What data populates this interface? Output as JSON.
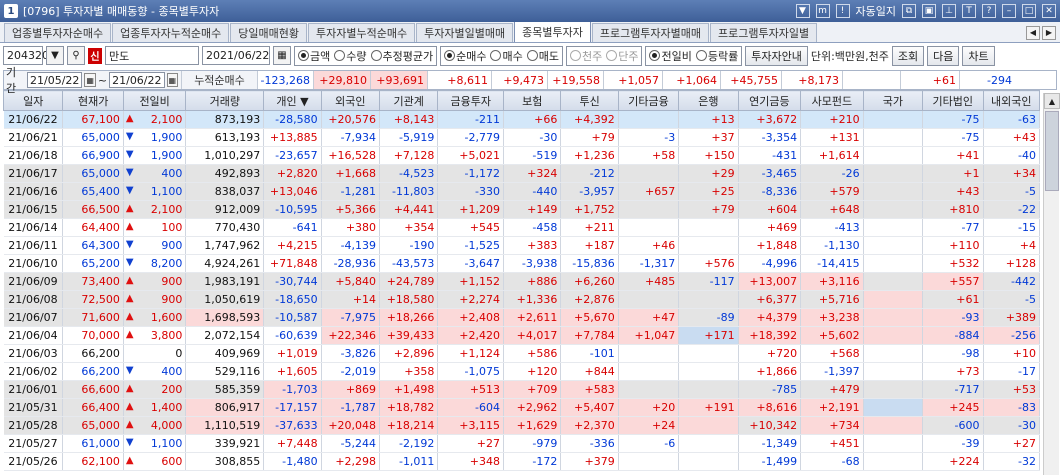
{
  "window": {
    "number": "1",
    "title": "[0796] 투자자별 매매동향 - 종목별투자자",
    "auto_notice": "자동일지",
    "help_icon": "?"
  },
  "tabs": [
    {
      "label": "업종별투자자순매수",
      "active": false
    },
    {
      "label": "업종투자자누적순매수",
      "active": false
    },
    {
      "label": "당일매매현황",
      "active": false
    },
    {
      "label": "투자자별누적순매수",
      "active": false
    },
    {
      "label": "투자자별일별매매",
      "active": false
    },
    {
      "label": "종목별투자자",
      "active": true
    },
    {
      "label": "프로그램투자자별매매",
      "active": false
    },
    {
      "label": "프로그램투자자일별",
      "active": false
    }
  ],
  "toolbar": {
    "code": "204320",
    "shin": "신",
    "name": "만도",
    "date": "2021/06/22",
    "unit_options": [
      {
        "label": "금액",
        "on": true
      },
      {
        "label": "수량",
        "on": false
      },
      {
        "label": "추정평균가",
        "on": false
      }
    ],
    "trade_options": [
      {
        "label": "순매수",
        "on": true
      },
      {
        "label": "매수",
        "on": false
      },
      {
        "label": "매도",
        "on": false
      }
    ],
    "scale_options": [
      {
        "label": "천주",
        "on": true
      },
      {
        "label": "단주",
        "on": false
      }
    ],
    "compare_options": [
      {
        "label": "전일비",
        "on": true
      },
      {
        "label": "등락률",
        "on": false
      }
    ],
    "guide_button": "투자자안내",
    "unit_text": "단위:백만원,천주",
    "query_button": "조회",
    "next_button": "다음",
    "chart_button": "차트"
  },
  "period": {
    "label": "기간",
    "from": "21/05/22",
    "to": "21/06/22",
    "sum_label": "누적순매수"
  },
  "summary": [
    "-123,268",
    "+29,810",
    "+93,691",
    "+8,611",
    "+9,473",
    "+19,558",
    "+1,057",
    "+1,064",
    "+45,755",
    "+8,173",
    "",
    "+61",
    "-294"
  ],
  "columns": [
    "일자",
    "현재가",
    "전일비",
    "거래량",
    "개인",
    "외국인",
    "기관계",
    "금융투자",
    "보험",
    "투신",
    "기타금융",
    "은행",
    "연기금등",
    "사모펀드",
    "국가",
    "기타법인",
    "내외국인"
  ],
  "rows": [
    [
      "21/06/22",
      "67,100",
      "up",
      "2,100",
      "873,193",
      "-28,580",
      "+20,576",
      "+8,143",
      "-211",
      "+66",
      "+4,392",
      "",
      "+13",
      "+3,672",
      "+210",
      "",
      "-75",
      "-63"
    ],
    [
      "21/06/21",
      "65,000",
      "dn",
      "1,900",
      "613,193",
      "+13,885",
      "-7,934",
      "-5,919",
      "-2,779",
      "-30",
      "+79",
      "-3",
      "+37",
      "-3,354",
      "+131",
      "",
      "-75",
      "+43"
    ],
    [
      "21/06/18",
      "66,900",
      "dn",
      "1,900",
      "1,010,297",
      "-23,657",
      "+16,528",
      "+7,128",
      "+5,021",
      "-519",
      "+1,236",
      "+58",
      "+150",
      "-431",
      "+1,614",
      "",
      "+41",
      "-40"
    ],
    [
      "21/06/17",
      "65,000",
      "dn",
      "400",
      "492,893",
      "+2,820",
      "+1,668",
      "-4,523",
      "-1,172",
      "+324",
      "-212",
      "",
      "+29",
      "-3,465",
      "-26",
      "",
      "+1",
      "+34"
    ],
    [
      "21/06/16",
      "65,400",
      "dn",
      "1,100",
      "838,037",
      "+13,046",
      "-1,281",
      "-11,803",
      "-330",
      "-440",
      "-3,957",
      "+657",
      "+25",
      "-8,336",
      "+579",
      "",
      "+43",
      "-5"
    ],
    [
      "21/06/15",
      "66,500",
      "up",
      "2,100",
      "912,009",
      "-10,595",
      "+5,366",
      "+4,441",
      "+1,209",
      "+149",
      "+1,752",
      "",
      "+79",
      "+604",
      "+648",
      "",
      "+810",
      "-22"
    ],
    [
      "21/06/14",
      "64,400",
      "up",
      "100",
      "770,430",
      "-641",
      "+380",
      "+354",
      "+545",
      "-458",
      "+211",
      "",
      "",
      "+469",
      "-413",
      "",
      "-77",
      "-15"
    ],
    [
      "21/06/11",
      "64,300",
      "dn",
      "900",
      "1,747,962",
      "+4,215",
      "-4,139",
      "-190",
      "-1,525",
      "+383",
      "+187",
      "+46",
      "",
      "+1,848",
      "-1,130",
      "",
      "+110",
      "+4"
    ],
    [
      "21/06/10",
      "65,200",
      "dn",
      "8,200",
      "4,924,261",
      "+71,848",
      "-28,936",
      "-43,573",
      "-3,647",
      "-3,938",
      "-15,836",
      "-1,317",
      "+576",
      "-4,996",
      "-14,415",
      "",
      "+532",
      "+128"
    ],
    [
      "21/06/09",
      "73,400",
      "up",
      "900",
      "1,983,191",
      "-30,744",
      "+5,840",
      "+24,789",
      "+1,152",
      "+886",
      "+6,260",
      "+485",
      "-117",
      "+13,007",
      "+3,116",
      "",
      "+557",
      "-442"
    ],
    [
      "21/06/08",
      "72,500",
      "up",
      "900",
      "1,050,619",
      "-18,650",
      "+14",
      "+18,580",
      "+2,274",
      "+1,336",
      "+2,876",
      "",
      "",
      "+6,377",
      "+5,716",
      "",
      "+61",
      "-5"
    ],
    [
      "21/06/07",
      "71,600",
      "up",
      "1,600",
      "1,698,593",
      "-10,587",
      "-7,975",
      "+18,266",
      "+2,408",
      "+2,611",
      "+5,670",
      "+47",
      "-89",
      "+4,379",
      "+3,238",
      "",
      "-93",
      "+389"
    ],
    [
      "21/06/04",
      "70,000",
      "up",
      "3,800",
      "2,072,154",
      "-60,639",
      "+22,346",
      "+39,433",
      "+2,420",
      "+4,017",
      "+7,784",
      "+1,047",
      "+171",
      "+18,392",
      "+5,602",
      "",
      "-884",
      "-256"
    ],
    [
      "21/06/03",
      "66,200",
      "",
      "0",
      "409,969",
      "+1,019",
      "-3,826",
      "+2,896",
      "+1,124",
      "+586",
      "-101",
      "",
      "",
      "+720",
      "+568",
      "",
      "-98",
      "+10"
    ],
    [
      "21/06/02",
      "66,200",
      "dn",
      "400",
      "529,116",
      "+1,605",
      "-2,019",
      "+358",
      "-1,075",
      "+120",
      "+844",
      "",
      "",
      "+1,866",
      "-1,397",
      "",
      "+73",
      "-17"
    ],
    [
      "21/06/01",
      "66,600",
      "up",
      "200",
      "585,359",
      "-1,703",
      "+869",
      "+1,498",
      "+513",
      "+709",
      "+583",
      "",
      "",
      "-785",
      "+479",
      "",
      "-717",
      "+53"
    ],
    [
      "21/05/31",
      "66,400",
      "up",
      "1,400",
      "806,917",
      "-17,157",
      "-1,787",
      "+18,782",
      "-604",
      "+2,962",
      "+5,407",
      "+20",
      "+191",
      "+8,616",
      "+2,191",
      "",
      "+245",
      "-83"
    ],
    [
      "21/05/28",
      "65,000",
      "up",
      "4,000",
      "1,110,519",
      "-37,633",
      "+20,048",
      "+18,214",
      "+3,115",
      "+1,629",
      "+2,370",
      "+24",
      "",
      "+10,342",
      "+734",
      "",
      "-600",
      "-30"
    ],
    [
      "21/05/27",
      "61,000",
      "dn",
      "1,100",
      "339,921",
      "+7,448",
      "-5,244",
      "-2,192",
      "+27",
      "-979",
      "-336",
      "-6",
      "",
      "-1,349",
      "+451",
      "",
      "-39",
      "+27"
    ],
    [
      "21/05/26",
      "62,100",
      "up",
      "600",
      "308,855",
      "-1,480",
      "+2,298",
      "-1,011",
      "+348",
      "-172",
      "+379",
      "",
      "",
      "-1,499",
      "-68",
      "",
      "+224",
      "-32"
    ]
  ],
  "colors": {
    "up": "#d80000",
    "down": "#0038d6",
    "accent": "#3e5f98",
    "highlight_red": "#fbd9d9",
    "highlight_blue": "#c9dcf1"
  }
}
